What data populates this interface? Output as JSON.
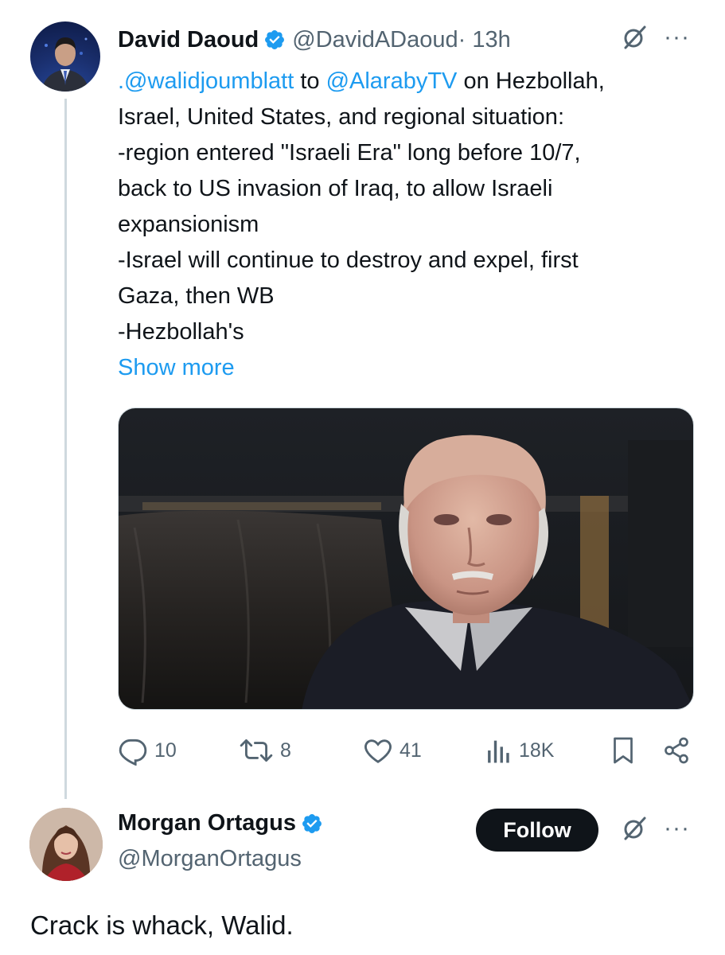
{
  "tweet1": {
    "author_name": "David Daoud",
    "handle": "@DavidADaoud",
    "time": " · 13h",
    "more": "···",
    "text": {
      "mention1": ".@walidjoumblatt",
      "line1_mid": " to ",
      "mention2": "@AlarabyTV",
      "line1_end": " on Hezbollah,",
      "line2": "Israel, United States, and regional situation:",
      "line3": "-region entered \"Israeli Era\" long before 10/7,",
      "line4": "back to US invasion of Iraq, to allow Israeli",
      "line5": "expansionism",
      "line6": "-Israel will continue to destroy and expel, first",
      "line7": "Gaza, then WB",
      "line8": "-Hezbollah's"
    },
    "show_more": "Show more",
    "stats": {
      "replies": "10",
      "reposts": "8",
      "likes": "41",
      "views": "18K"
    }
  },
  "tweet2": {
    "author_name": "Morgan Ortagus",
    "handle": "@MorganOrtagus",
    "follow_label": "Follow",
    "more": "···",
    "text": "Crack is whack, Walid."
  },
  "colors": {
    "accent": "#1d9bf0",
    "text": "#0f1419",
    "secondary": "#536471",
    "divider": "#cfd9de"
  },
  "icons": [
    "verified-badge-icon",
    "grok-icon",
    "more-icon",
    "reply-icon",
    "repost-icon",
    "like-icon",
    "views-icon",
    "bookmark-icon",
    "share-icon"
  ]
}
